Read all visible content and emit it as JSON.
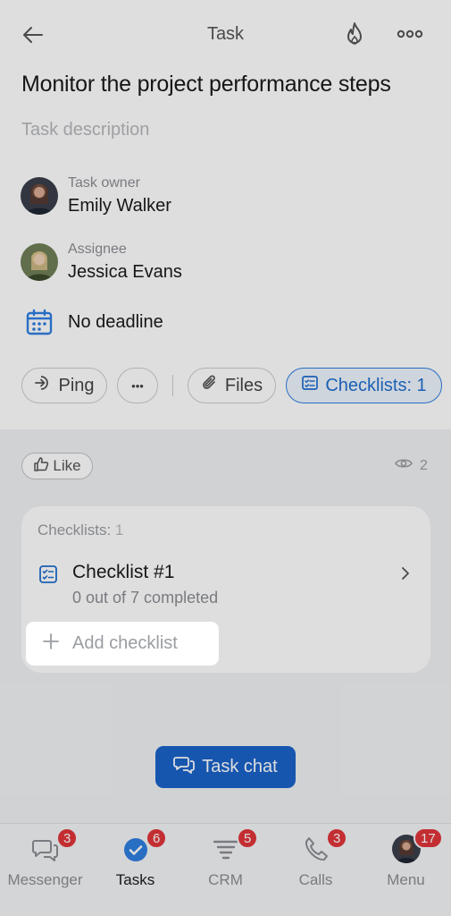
{
  "header": {
    "title": "Task",
    "back_icon": "arrow-left-icon",
    "fire_icon": "flame-icon",
    "more_icon": "more-horizontal-icon"
  },
  "task": {
    "title": "Monitor the project performance steps",
    "description_placeholder": "Task description"
  },
  "owner": {
    "label": "Task owner",
    "name": "Emily Walker"
  },
  "assignee": {
    "label": "Assignee",
    "name": "Jessica Evans"
  },
  "deadline": {
    "text": "No deadline",
    "icon": "calendar-icon"
  },
  "actions": {
    "ping_label": "Ping",
    "more_label": "•••",
    "files_label": "Files",
    "checklists_label": "Checklists: 1"
  },
  "social": {
    "like_label": "Like",
    "views_count": "2"
  },
  "checklists_card": {
    "heading": "Checklists:",
    "heading_count": "1",
    "items": [
      {
        "name": "Checklist #1",
        "progress": "0 out of 7 completed"
      }
    ],
    "add_label": "Add checklist"
  },
  "task_chat_label": "Task chat",
  "bottom_nav": [
    {
      "label": "Messenger",
      "badge": "3",
      "icon": "chat-bubbles-icon"
    },
    {
      "label": "Tasks",
      "badge": "6",
      "icon": "check-circle-icon"
    },
    {
      "label": "CRM",
      "badge": "5",
      "icon": "funnel-icon"
    },
    {
      "label": "Calls",
      "badge": "3",
      "icon": "phone-icon"
    },
    {
      "label": "Menu",
      "badge": "17",
      "icon": "user-avatar"
    }
  ],
  "colors": {
    "accent": "#2f7fe0",
    "primary_button": "#1b63c9",
    "badge": "#e0353a",
    "muted_text": "#8b8e94"
  }
}
